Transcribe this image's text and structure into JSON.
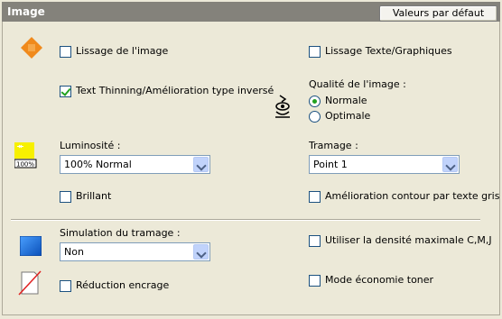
{
  "header": {
    "title": "Image",
    "default_button": "Valeurs par défaut"
  },
  "options": {
    "lissage_image": {
      "label": "Lissage de l'image",
      "checked": false
    },
    "lissage_texte": {
      "label": "Lissage Texte/Graphiques",
      "checked": false
    },
    "text_thinning": {
      "label": "Text Thinning/Amélioration type inversé",
      "checked": true
    },
    "brillant": {
      "label": "Brillant",
      "checked": false
    },
    "amelioration_contour": {
      "label": "Amélioration contour par texte gris",
      "checked": false
    },
    "densite_max": {
      "label": "Utiliser la densité maximale C,M,J",
      "checked": false
    },
    "reduction_encrage": {
      "label": "Réduction encrage",
      "checked": false
    },
    "economie_toner": {
      "label": "Mode économie toner",
      "checked": false
    }
  },
  "qualite": {
    "label": "Qualité de l'image :",
    "options": [
      "Normale",
      "Optimale"
    ],
    "selected": "Normale"
  },
  "luminosite": {
    "label": "Luminosité :",
    "value": "100% Normal",
    "icon_text": "100%"
  },
  "tramage": {
    "label": "Tramage :",
    "value": "Point 1"
  },
  "simulation": {
    "label": "Simulation du tramage :",
    "value": "Non"
  },
  "icons": [
    "smoothing-icon",
    "quality-icon",
    "brightness-icon",
    "halftone-icon",
    "toner-reduction-icon"
  ],
  "colors": {
    "titlebar": "#84827b",
    "panel": "#ece9d8",
    "smoothing_icon": "#f08a1c",
    "brightness_icon": "#f7f000",
    "halftone_icon": "#1a6fd6",
    "check": "#21a121"
  }
}
